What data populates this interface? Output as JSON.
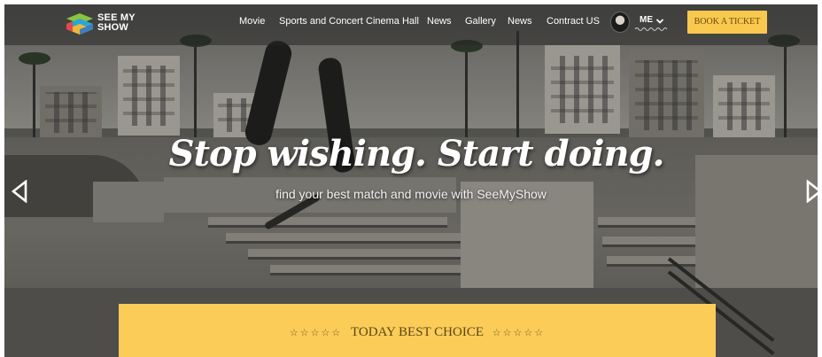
{
  "brand": {
    "line1": "SEE MY",
    "line2": "SHOW",
    "logo_icon": "stacked-layers-icon",
    "logo_colors": [
      "#2aa6d6",
      "#f0b836",
      "#8ac43f",
      "#e2474f"
    ]
  },
  "nav": {
    "items": [
      {
        "label": "Movie"
      },
      {
        "label": "Sports and Concert"
      },
      {
        "label": "Cinema Hall"
      },
      {
        "label": "News"
      },
      {
        "label": "Gallery"
      },
      {
        "label": "News"
      },
      {
        "label": "Contract US"
      }
    ],
    "user_label": "ME",
    "user_caret_icon": "chevron-down-icon",
    "book_button": "BOOK A TICKET"
  },
  "hero": {
    "headline": "Stop wishing. Start doing.",
    "subline": "find your best match and movie with SeeMyShow",
    "prev_icon": "triangle-left-icon",
    "next_icon": "triangle-right-icon"
  },
  "banner": {
    "stars_left": "☆☆☆☆☆",
    "title": "TODAY BEST CHOICE",
    "stars_right": "☆☆☆☆☆"
  },
  "colors": {
    "accent": "#f8c94e",
    "banner": "#fbcc57",
    "nav_bg": "#262626"
  }
}
